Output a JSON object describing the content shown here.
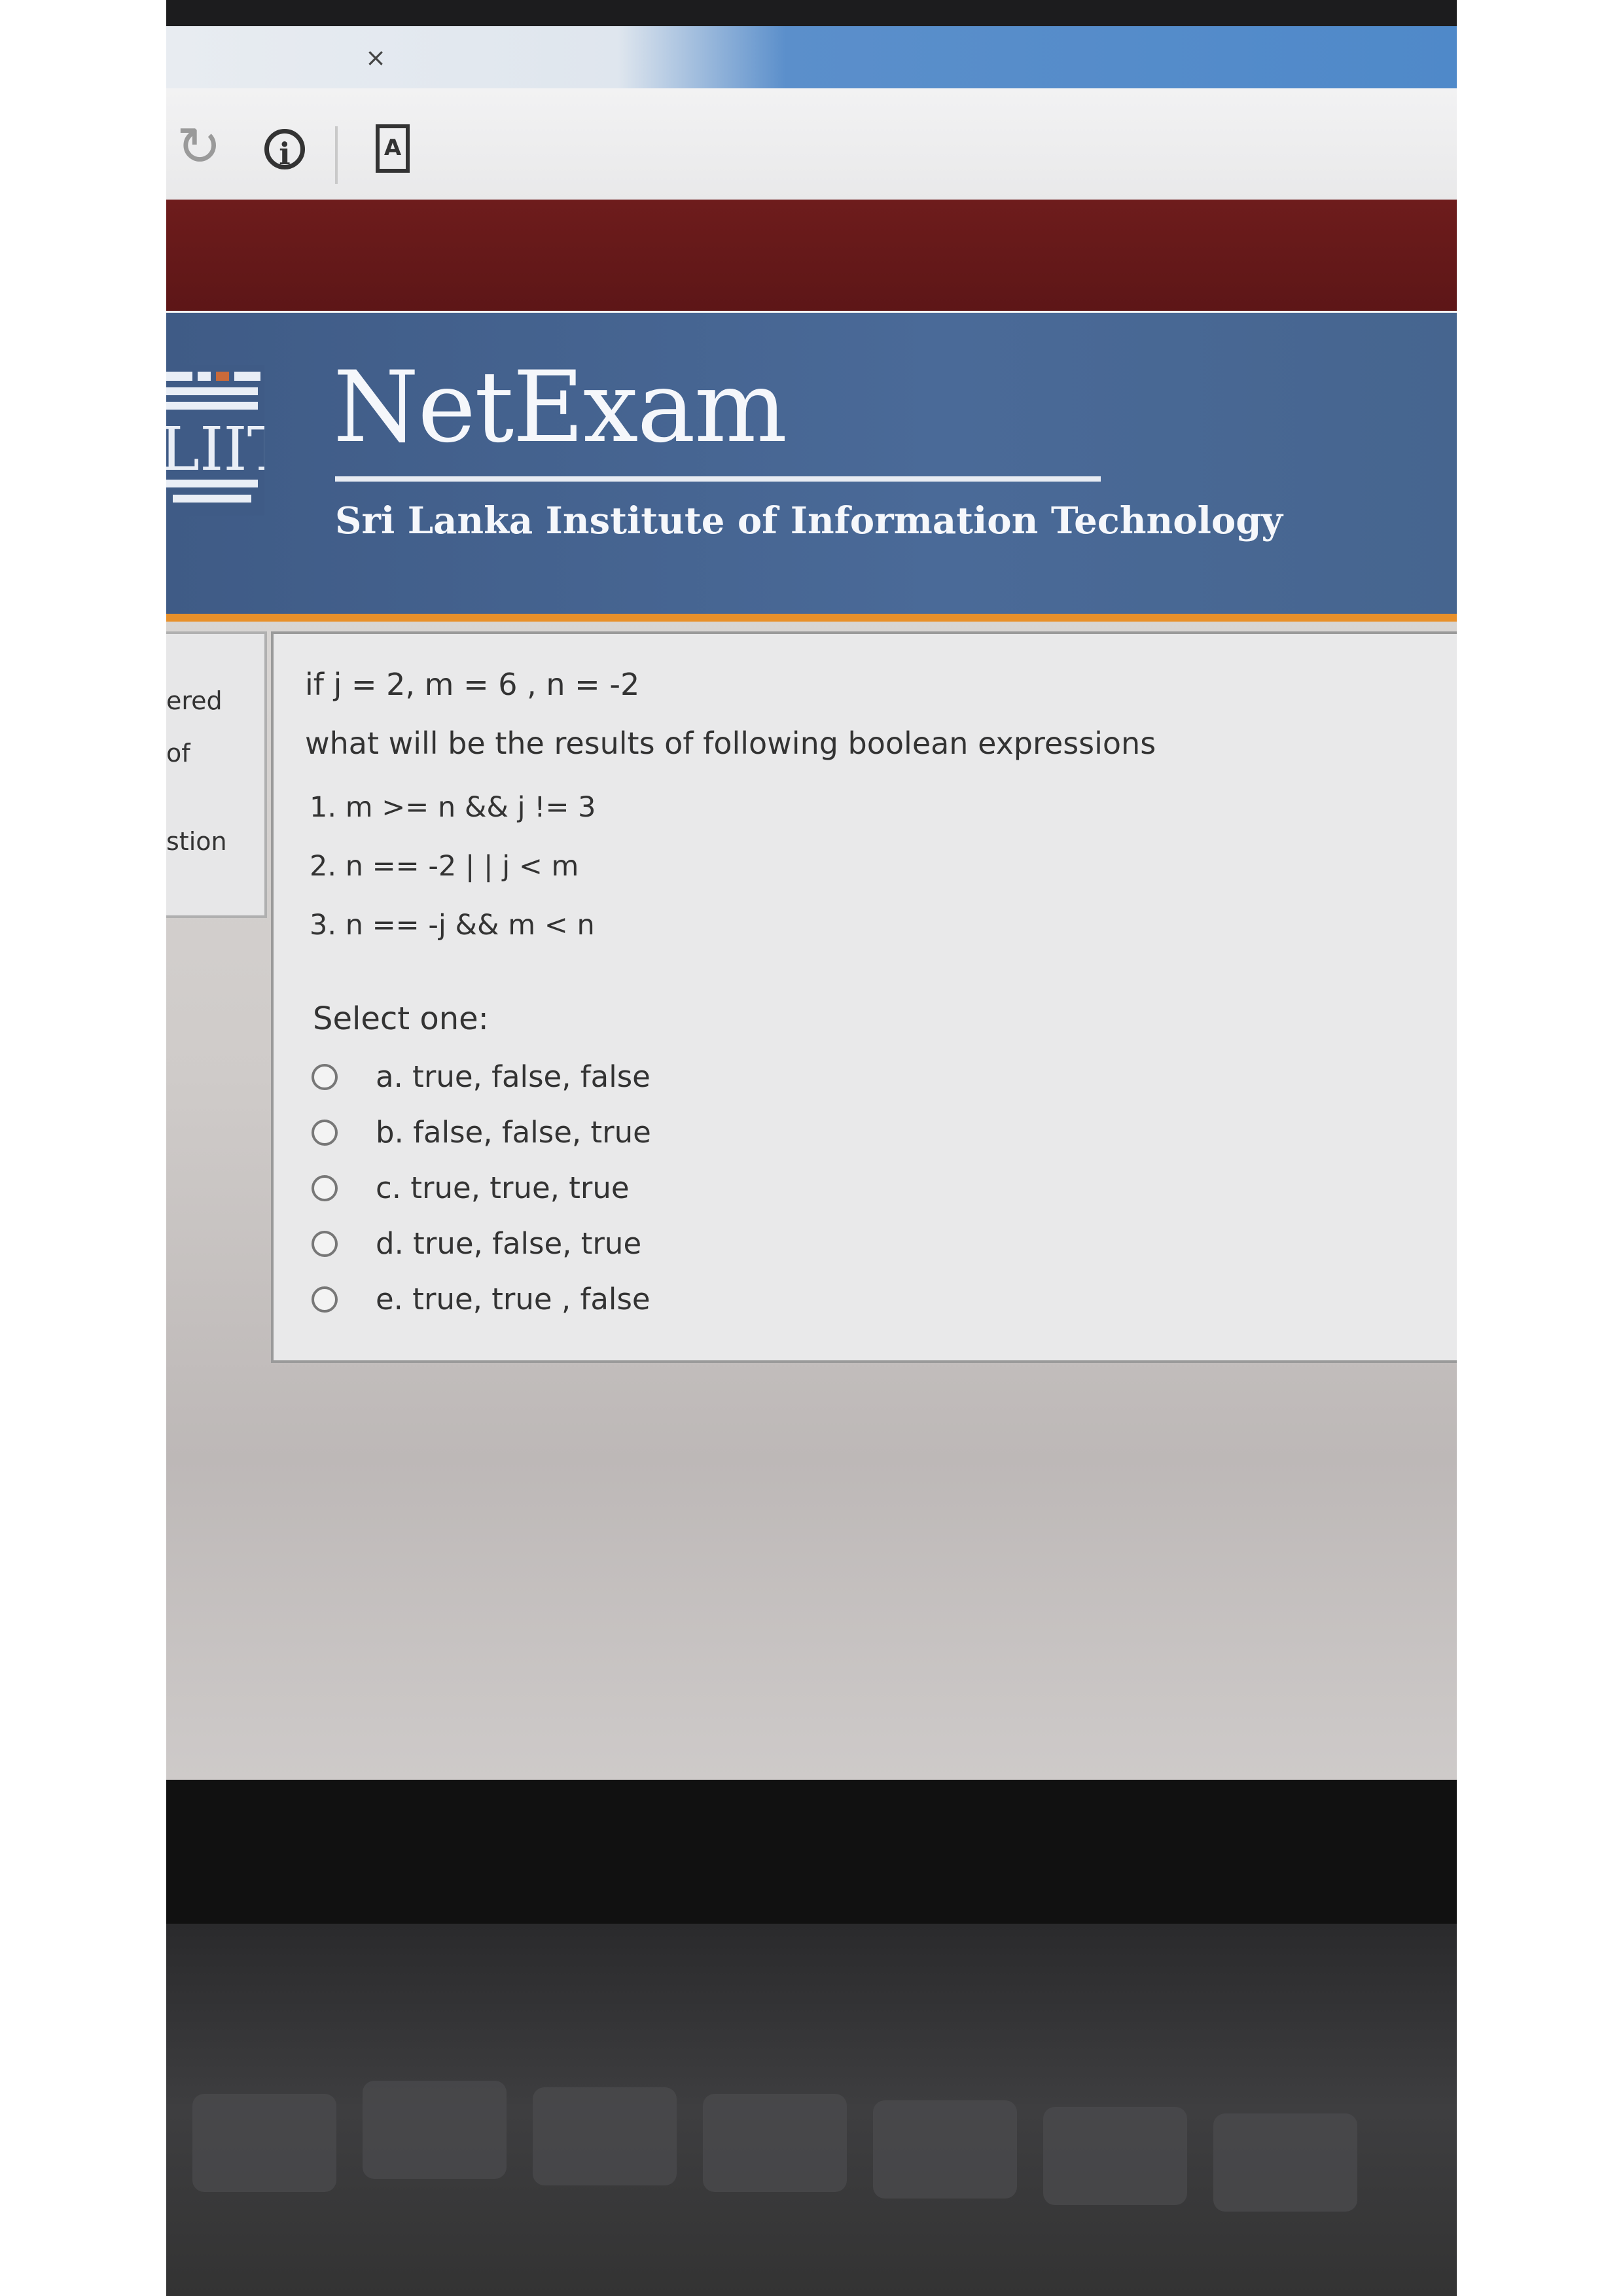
{
  "browser": {
    "tab_close": "×",
    "reload_icon": "reload-icon",
    "info_icon": "info-icon",
    "page_icon": "page-icon"
  },
  "header": {
    "logo_text": "LIIT",
    "title": "NetExam",
    "subtitle": "Sri Lanka Institute of Information Technology"
  },
  "leftnav": {
    "line1": "ered",
    "line2": "of",
    "line3": "stion"
  },
  "question": {
    "line1": "if j = 2, m = 6 , n = -2",
    "line2": "what will be the results of following boolean expressions",
    "expr1": "1. m >= n && j != 3",
    "expr2": "2. n == -2 | | j < m",
    "expr3": "3. n == -j &&  m < n",
    "select_label": "Select one:",
    "options": [
      {
        "label": "a. true, false, false"
      },
      {
        "label": "b. false, false, true"
      },
      {
        "label": "c. true, true, true"
      },
      {
        "label": "d. true, false, true"
      },
      {
        "label": "e. true, true , false"
      }
    ]
  },
  "colors": {
    "maroon": "#6e1c1c",
    "header_blue": "#4a6a98",
    "accent_orange": "#e8902a"
  }
}
